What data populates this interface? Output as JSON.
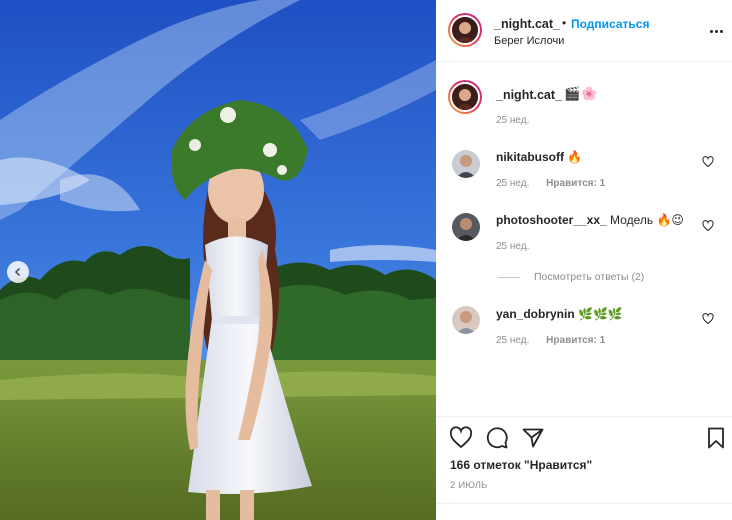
{
  "post": {
    "username": "_night.cat_",
    "separator": "•",
    "follow_label": "Подписаться",
    "location": "Берег Ислочи",
    "more_icon": "more-horizontal-icon"
  },
  "caption": {
    "username": "_night.cat_",
    "emojis": [
      "🎬",
      "🌸"
    ],
    "time": "25 нед."
  },
  "comments": [
    {
      "username": "nikitabusoff",
      "text": "🔥",
      "time": "25 нед.",
      "likes": "Нравится: 1"
    },
    {
      "username": "photoshooter__xx_",
      "text": "Модель 🔥😉",
      "time": "25 нед.",
      "likes": ""
    },
    {
      "username": "yan_dobrynin",
      "text": "🌿🌿🌿",
      "time": "25 нед.",
      "likes": "Нравится: 1"
    }
  ],
  "view_replies": "Посмотреть ответы (2)",
  "footer": {
    "likes_count": "166 отметок \"Нравится\"",
    "date": "2 ИЮЛЬ"
  },
  "colors": {
    "accent": "#0095f6",
    "text": "#262626",
    "muted": "#8e8e8e"
  }
}
